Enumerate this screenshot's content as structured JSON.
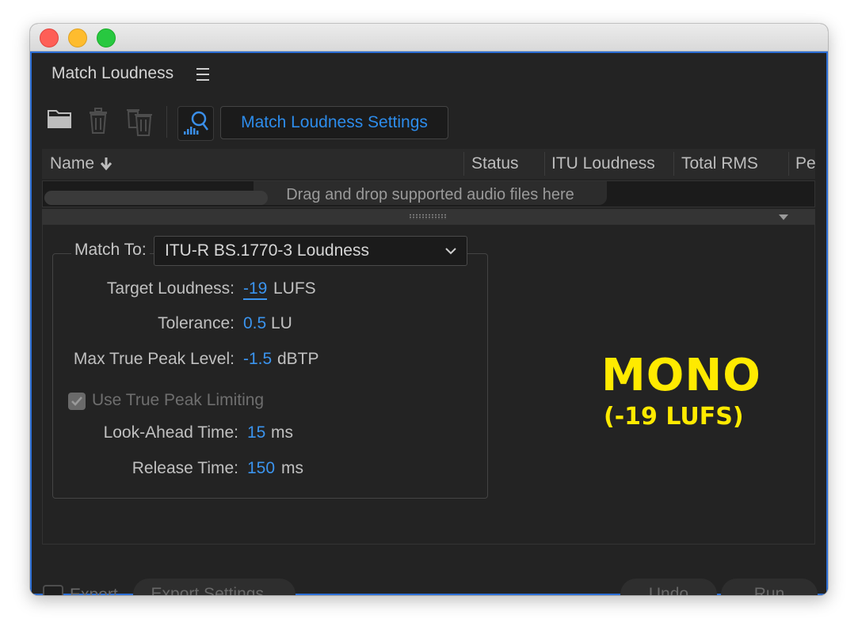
{
  "panel": {
    "title": "Match Loudness"
  },
  "toolbar": {
    "settings_label": "Match Loudness Settings"
  },
  "columns": [
    {
      "label": "Name"
    },
    {
      "label": "Status"
    },
    {
      "label": "ITU Loudness"
    },
    {
      "label": "Total RMS"
    },
    {
      "label": "Pe"
    }
  ],
  "file_list": {
    "drop_hint": "Drag and drop supported audio files here"
  },
  "settings": {
    "match_to_label": "Match To:",
    "match_to_value": "ITU-R BS.1770-3 Loudness",
    "target_loudness": {
      "label": "Target Loudness:",
      "value": "-19",
      "unit": "LUFS"
    },
    "tolerance": {
      "label": "Tolerance:",
      "value": "0.5",
      "unit": "LU"
    },
    "max_true_peak": {
      "label": "Max True Peak Level:",
      "value": "-1.5",
      "unit": "dBTP"
    },
    "use_true_peak_limiting": {
      "label": "Use True Peak Limiting",
      "checked": true,
      "enabled": false
    },
    "look_ahead": {
      "label": "Look-Ahead Time:",
      "value": "15",
      "unit": "ms"
    },
    "release": {
      "label": "Release Time:",
      "value": "150",
      "unit": "ms"
    }
  },
  "overlay": {
    "title": "MONO",
    "subtitle": "(-19 LUFS)",
    "color": "#ffea00"
  },
  "footer": {
    "export_label": "Export",
    "export_checked": false,
    "export_settings_label": "Export Settings...",
    "undo_label": "Undo",
    "run_label": "Run"
  },
  "colors": {
    "accent": "#2d8ceb",
    "focus_border": "#2d6fd6",
    "background": "#232323"
  }
}
